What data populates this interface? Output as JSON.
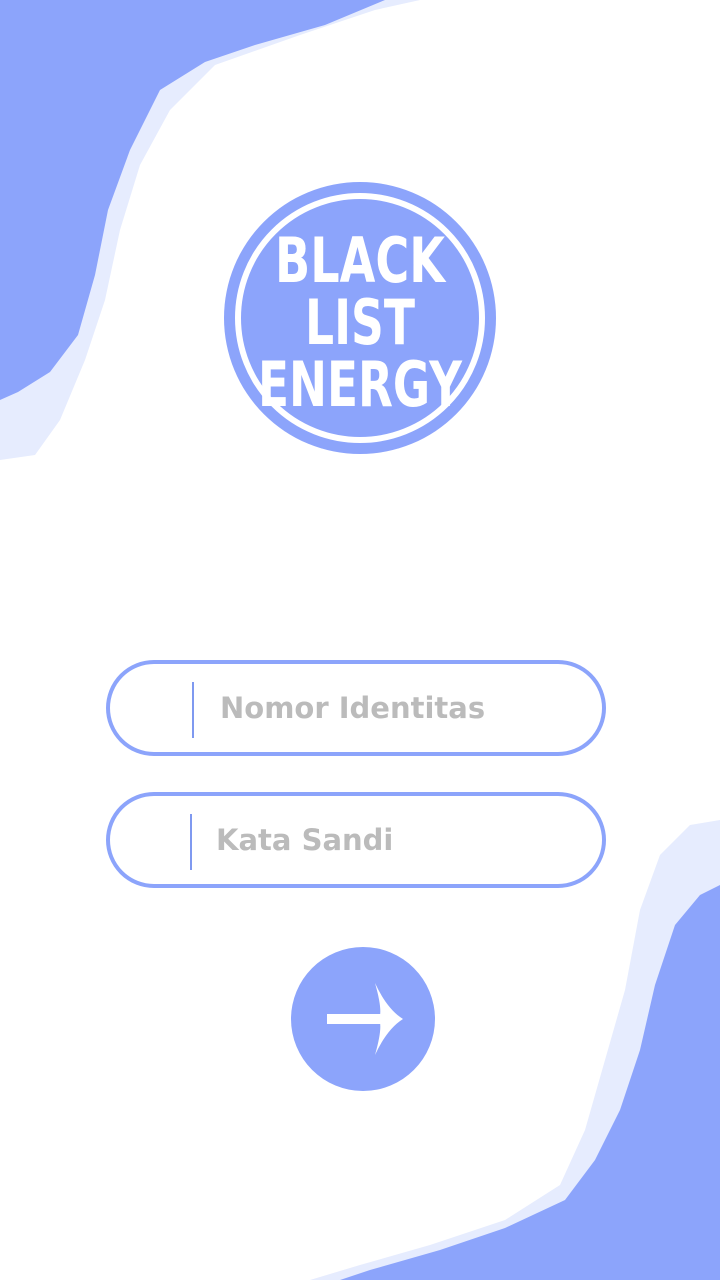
{
  "logo": {
    "line1": "BLACK",
    "line2": "LIST",
    "line3": "ENERGY"
  },
  "form": {
    "identity_placeholder": "Nomor Identitas",
    "password_placeholder": "Kata Sandi"
  },
  "submit": {
    "icon": "arrow-right-icon"
  },
  "colors": {
    "accent": "#8ca4fb",
    "accent_light": "#e6ecfe",
    "placeholder": "#bbbbbb",
    "background": "#ffffff"
  }
}
